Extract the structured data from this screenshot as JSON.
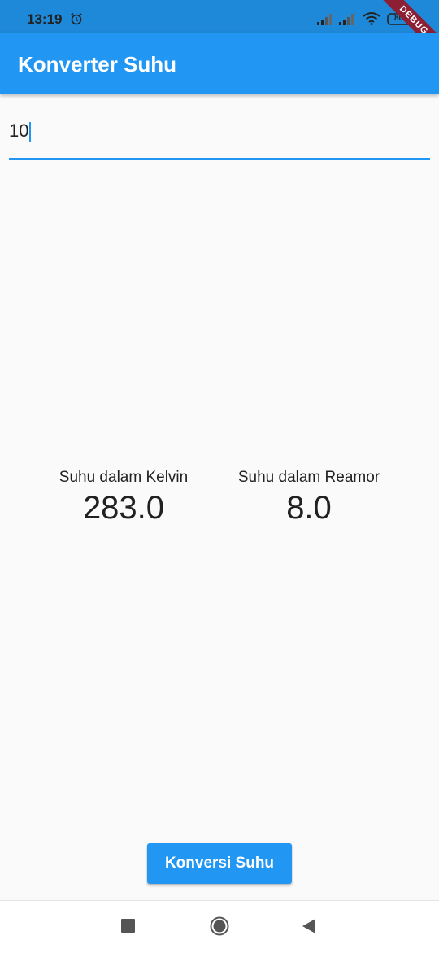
{
  "status_bar": {
    "time": "13:19",
    "battery": "80",
    "debug_label": "DEBUG",
    "icons": [
      "alarm-icon",
      "signal-icon",
      "signal-icon",
      "wifi-icon",
      "battery-icon"
    ]
  },
  "app_bar": {
    "title": "Konverter Suhu",
    "color": "#2196f3"
  },
  "input": {
    "value": "10"
  },
  "results": {
    "kelvin": {
      "label": "Suhu dalam Kelvin",
      "value": "283.0"
    },
    "reamur": {
      "label": "Suhu dalam Reamor",
      "value": "8.0"
    }
  },
  "button": {
    "label": "Konversi Suhu"
  },
  "nav_bar": {
    "icons": [
      "recent-apps-icon",
      "home-icon",
      "back-icon"
    ]
  }
}
